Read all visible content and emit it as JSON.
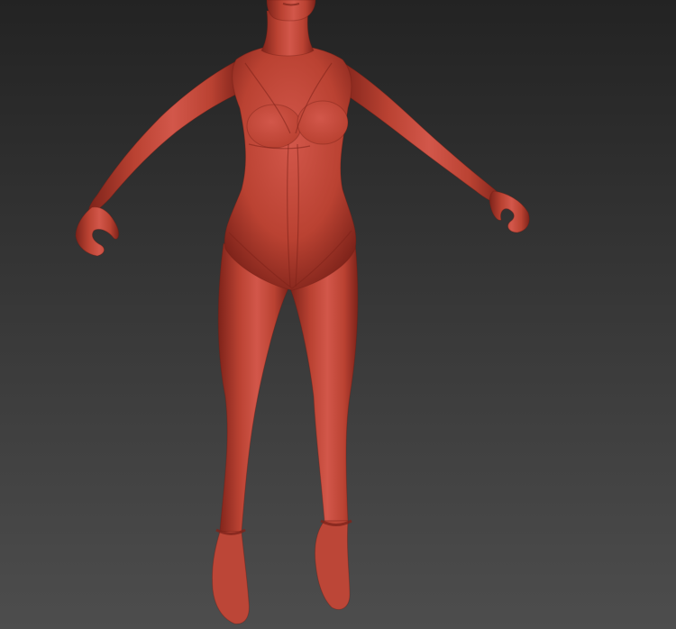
{
  "viewport": {
    "background_top": "#232323",
    "background_bottom": "#4d4d4d"
  },
  "model": {
    "icon": "figure-sculpt-icon",
    "skin_light": "#d2574a",
    "skin_base": "#ba4232",
    "skin_dark": "#7e231a",
    "shoe_color": "#bc4637"
  }
}
